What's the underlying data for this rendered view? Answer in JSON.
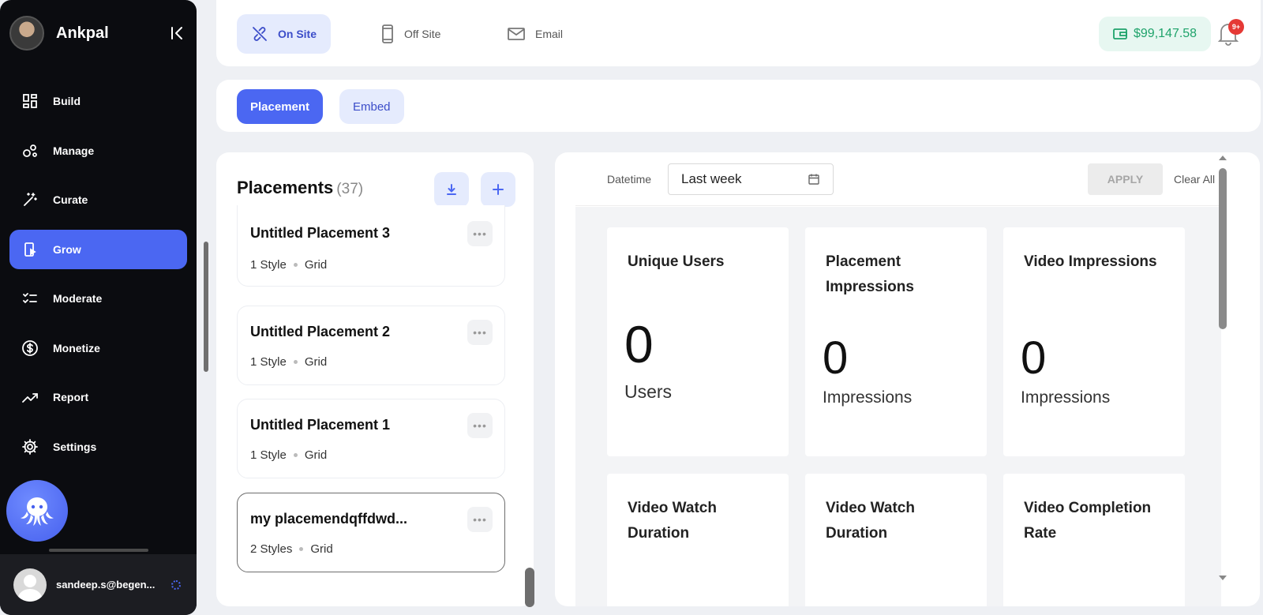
{
  "sidebar": {
    "brand_name": "Ankpal",
    "items": [
      {
        "label": "Build",
        "icon": "build-icon"
      },
      {
        "label": "Manage",
        "icon": "manage-icon"
      },
      {
        "label": "Curate",
        "icon": "wand-icon"
      },
      {
        "label": "Grow",
        "icon": "grow-icon",
        "active": true
      },
      {
        "label": "Moderate",
        "icon": "checklist-icon"
      },
      {
        "label": "Monetize",
        "icon": "dollar-icon"
      },
      {
        "label": "Report",
        "icon": "trend-icon"
      },
      {
        "label": "Settings",
        "icon": "gear-icon"
      }
    ],
    "user_email": "sandeep.s@begen..."
  },
  "topbar": {
    "tabs": [
      {
        "label": "On Site",
        "icon": "link-off-icon",
        "active": true
      },
      {
        "label": "Off Site",
        "icon": "phone-icon"
      },
      {
        "label": "Email",
        "icon": "mail-icon"
      }
    ],
    "balance": "$99,147.58",
    "notifications_badge": "9+"
  },
  "subtabs": [
    {
      "label": "Placement",
      "active": true
    },
    {
      "label": "Embed"
    }
  ],
  "placements": {
    "title": "Placements",
    "count": "(37)",
    "items": [
      {
        "title": "Untitled Placement 3",
        "styles": "1 Style",
        "layout": "Grid"
      },
      {
        "title": "Untitled Placement 2",
        "styles": "1 Style",
        "layout": "Grid"
      },
      {
        "title": "Untitled Placement 1",
        "styles": "1 Style",
        "layout": "Grid"
      },
      {
        "title": "my placemendqffdwd...",
        "styles": "2 Styles",
        "layout": "Grid",
        "selected": true
      }
    ],
    "menu_glyph": "•••"
  },
  "filters": {
    "label": "Datetime",
    "date_value": "Last week",
    "apply_label": "APPLY",
    "clear_label": "Clear All"
  },
  "metrics": [
    {
      "title": "Unique Users",
      "value": "0",
      "unit": "Users"
    },
    {
      "title": "Placement Impressions",
      "value": "0",
      "unit": "Impressions"
    },
    {
      "title": "Video Impressions",
      "value": "0",
      "unit": "Impressions"
    },
    {
      "title": "Video Watch Duration",
      "value": "",
      "unit": ""
    },
    {
      "title": "Video Watch Duration",
      "value": "",
      "unit": ""
    },
    {
      "title": "Video Completion Rate",
      "value": "",
      "unit": ""
    }
  ],
  "colors": {
    "accent": "#4b67f2",
    "accent_light": "#e5ebfd",
    "sidebar_bg": "#0b0c10",
    "balance_green": "#1fa36b",
    "badge_red": "#e53935"
  }
}
